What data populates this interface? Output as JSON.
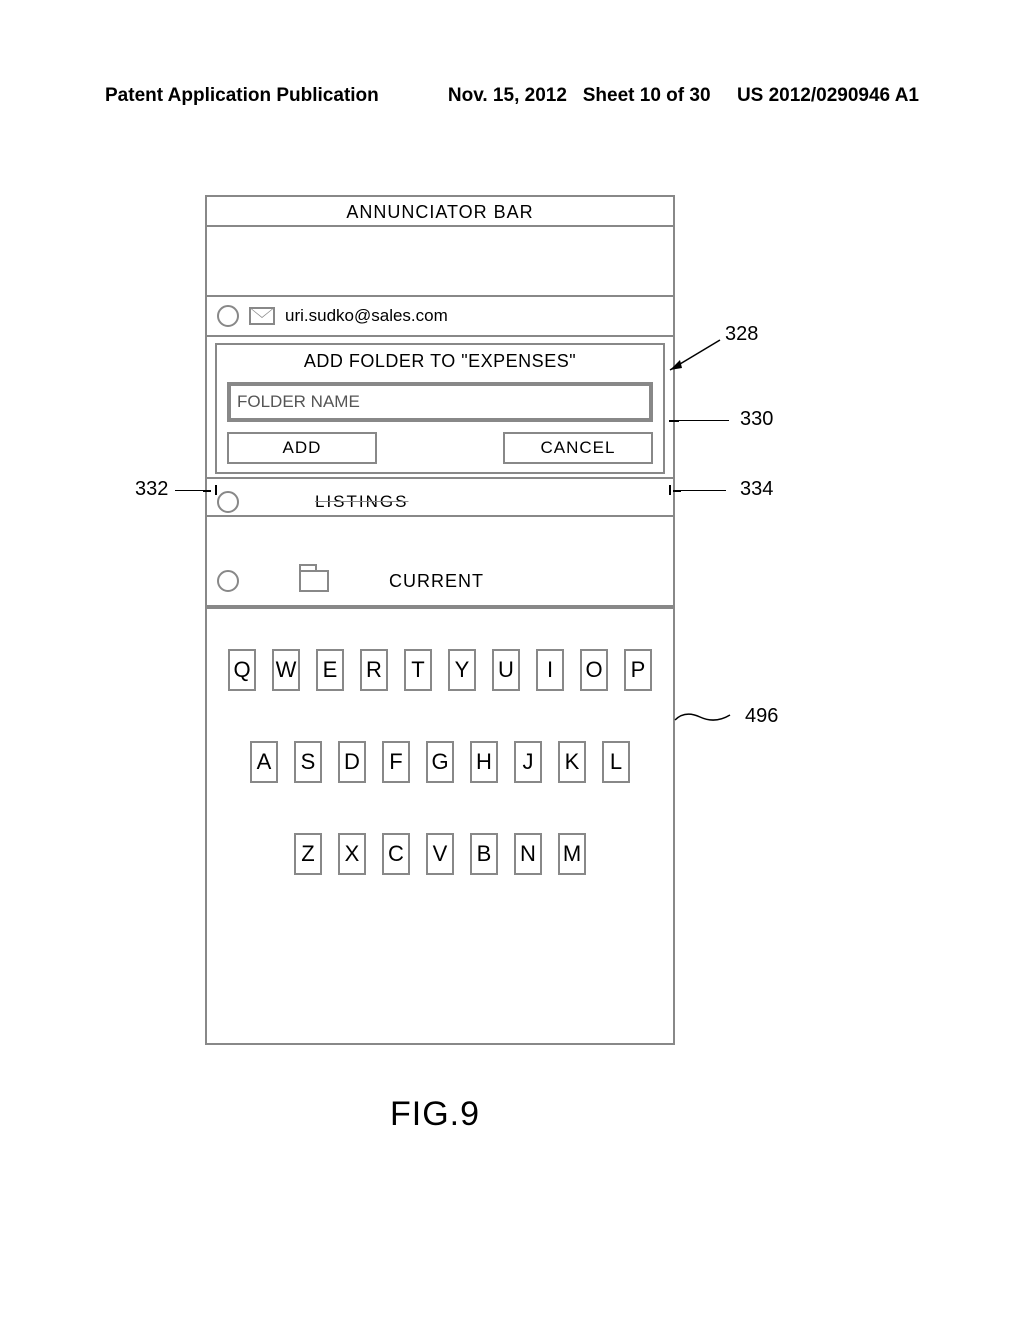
{
  "header": {
    "left": "Patent Application Publication",
    "date": "Nov. 15, 2012",
    "sheet": "Sheet 10 of 30",
    "pubnum": "US 2012/0290946 A1"
  },
  "device": {
    "annunciator": "ANNUNCIATOR BAR",
    "account_email": "uri.sudko@sales.com",
    "dialog_title": "ADD FOLDER TO \"EXPENSES\"",
    "folder_placeholder": "FOLDER NAME",
    "add_label": "ADD",
    "cancel_label": "CANCEL",
    "listings_label": "LISTINGS",
    "current_label": "CURRENT"
  },
  "keyboard": {
    "row1": [
      "Q",
      "W",
      "E",
      "R",
      "T",
      "Y",
      "U",
      "I",
      "O",
      "P"
    ],
    "row2": [
      "A",
      "S",
      "D",
      "F",
      "G",
      "H",
      "J",
      "K",
      "L"
    ],
    "row3": [
      "Z",
      "X",
      "C",
      "V",
      "B",
      "N",
      "M"
    ]
  },
  "callouts": {
    "c328": "328",
    "c330": "330",
    "c332": "332",
    "c334": "334",
    "c496": "496"
  },
  "figure_label": "FIG.9"
}
